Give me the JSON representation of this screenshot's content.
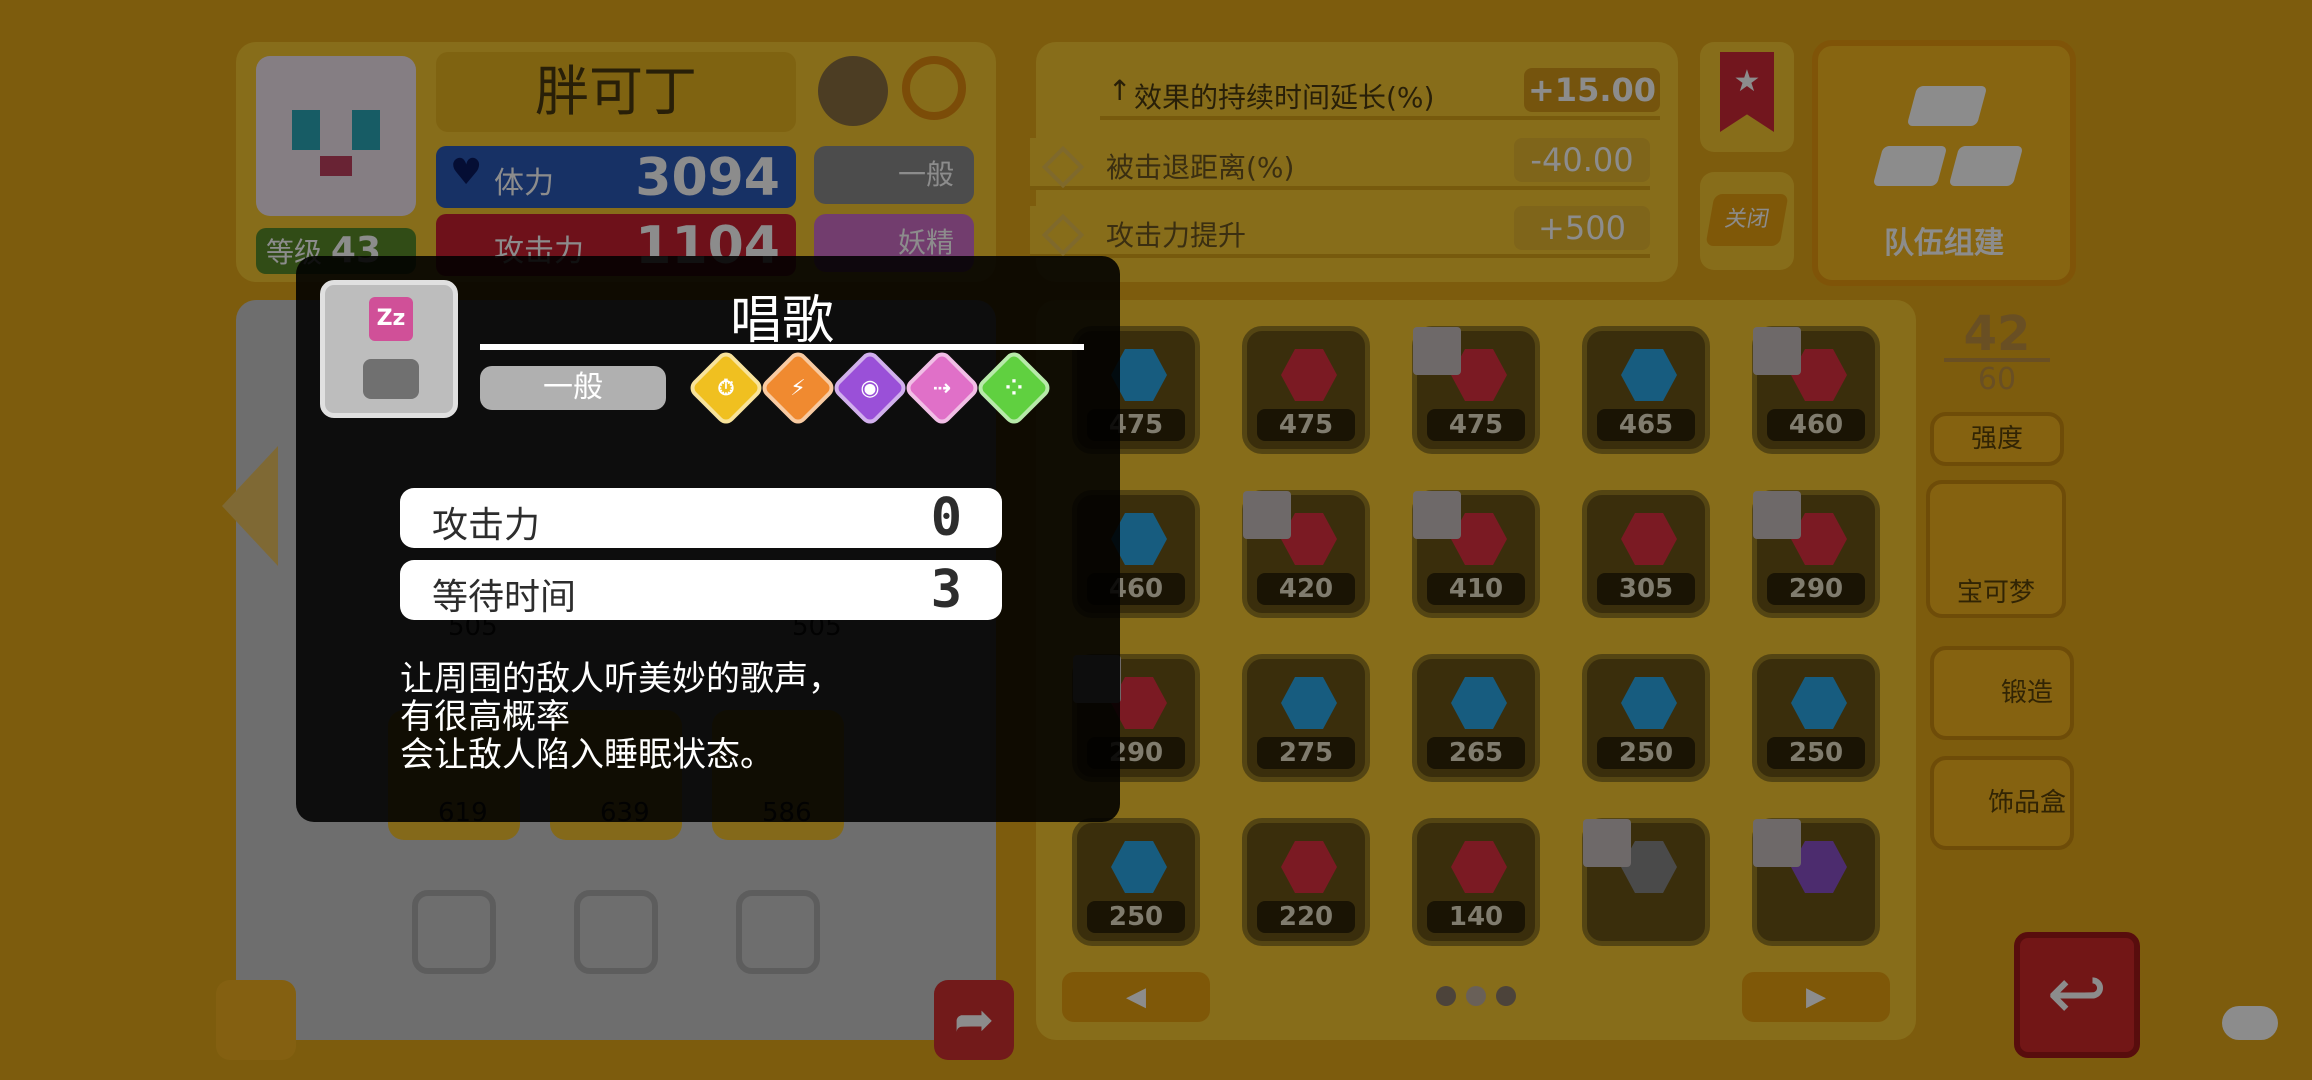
{
  "pokemon": {
    "name": "胖可丁",
    "level_label": "等级",
    "level": "43",
    "hp_label": "体力",
    "hp": "3094",
    "atk_label": "攻击力",
    "atk": "1104",
    "type1": "一般",
    "type2": "妖精"
  },
  "bonuses": [
    {
      "label": "效果的持续时间延长(%)",
      "value": "+15.00"
    },
    {
      "label": "被击退距离(%)",
      "value": "-40.00"
    },
    {
      "label": "攻击力提升",
      "value": "+500"
    }
  ],
  "close_label": "关闭",
  "team_build_label": "队伍组建",
  "capacity": {
    "current": "42",
    "max": "60"
  },
  "side_buttons": {
    "strength": "强度",
    "pokemon": "宝可梦",
    "forge": "锻造",
    "decor": "饰品盒"
  },
  "gems": [
    [
      "475",
      "475",
      "475",
      "465",
      "460"
    ],
    [
      "460",
      "420",
      "410",
      "305",
      "290"
    ],
    [
      "290",
      "275",
      "265",
      "250",
      "250"
    ],
    [
      "250",
      "220",
      "140",
      "",
      ""
    ]
  ],
  "slot_values": [
    "505",
    "505",
    "619",
    "639",
    "586"
  ],
  "nav": {
    "prev": "◀",
    "next": "▶"
  },
  "colors": {
    "gem_blue": "#2aa8e8",
    "gem_red": "#e03040",
    "popup_bg": "#111111",
    "accent_yellow": "#f6c630"
  },
  "popup": {
    "title": "唱歌",
    "type": "一般",
    "stats": [
      {
        "label": "攻击力",
        "value": "0"
      },
      {
        "label": "等待时间",
        "value": "3"
      }
    ],
    "desc": [
      "让周围的敌人听美妙的歌声，",
      "有很高概率",
      "会让敌人陷入睡眠状态。"
    ],
    "badges": [
      {
        "icon": "clock-icon",
        "color": "#f0c020"
      },
      {
        "icon": "lightning-x2-icon",
        "color": "#f08a30"
      },
      {
        "icon": "wifi-icon",
        "color": "#9a50d8"
      },
      {
        "icon": "arrow-icon",
        "color": "#e070c8"
      },
      {
        "icon": "dots-icon",
        "color": "#60d040"
      }
    ]
  }
}
